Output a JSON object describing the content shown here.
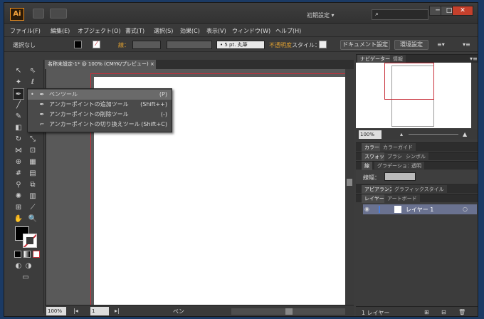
{
  "app": {
    "logo_text": "Ai",
    "workspace": "初期設定",
    "search_placeholder": ""
  },
  "window_controls": {
    "minimize": "─",
    "maximize": "□",
    "close": "✕"
  },
  "menu": [
    "ファイル(F)",
    "編集(E)",
    "オブジェクト(O)",
    "書式(T)",
    "選択(S)",
    "効果(C)",
    "表示(V)",
    "ウィンドウ(W)",
    "ヘルプ(H)"
  ],
  "control_bar": {
    "selection_state": "選択なし",
    "stroke_label": "線：",
    "brush_value": "5 pt. 丸筆",
    "opacity_label": "不透明度",
    "style_label": "スタイル：",
    "document_setup": "ドキュメント設定",
    "preferences": "環境設定"
  },
  "document": {
    "tab_title": "名称未設定-1* @ 100% (CMYK/プレビュー)",
    "zoom": "100%",
    "page": "1",
    "status_tool": "ペン"
  },
  "pen_flyout": {
    "items": [
      {
        "label": "ペンツール",
        "shortcut": "(P)",
        "icon": "pen-icon"
      },
      {
        "label": "アンカーポイントの追加ツール",
        "shortcut": "(Shift++)",
        "icon": "add-anchor-icon"
      },
      {
        "label": "アンカーポイントの削除ツール",
        "shortcut": "(-)",
        "icon": "delete-anchor-icon"
      },
      {
        "label": "アンカーポイントの切り換えツール",
        "shortcut": "(Shift+C)",
        "icon": "convert-anchor-icon"
      }
    ]
  },
  "panels": {
    "navigator": {
      "tab": "ナビゲーター",
      "info_tab": "情報",
      "zoom": "100%"
    },
    "color": {
      "tab": "カラー",
      "guide_tab": "カラーガイド"
    },
    "swatches": {
      "tab": "スウォッチ",
      "brush_tab": "ブラシ",
      "symbol_tab": "シンボル"
    },
    "stroke": {
      "tab": "線",
      "gradient_tab": "グラデーション",
      "transparency_tab": "透明",
      "weight_label": "線幅："
    },
    "appearance": {
      "tab": "アピアランス",
      "graphic_style_tab": "グラフィックスタイル"
    },
    "layers": {
      "tab": "レイヤー",
      "artboard_tab": "アートボード",
      "layer_name": "レイヤー 1",
      "footer": "1 レイヤー"
    }
  },
  "colors": {
    "accent_red": "#c8303a",
    "logo_orange": "#f0901e",
    "layer_highlight": "#6a7290",
    "opacity_label": "#e0a030"
  }
}
